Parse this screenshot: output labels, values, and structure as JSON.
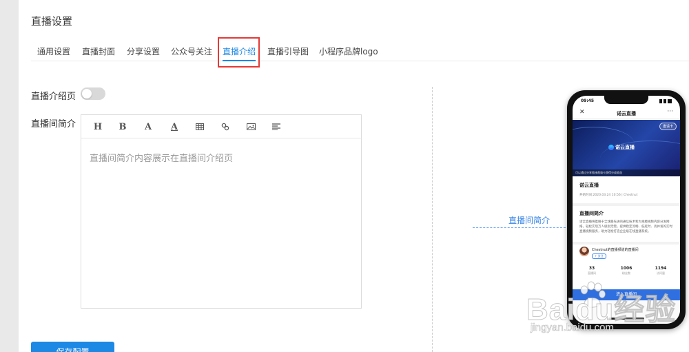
{
  "page": {
    "title": "直播设置"
  },
  "tabs": [
    {
      "label": "通用设置",
      "active": false
    },
    {
      "label": "直播封面",
      "active": false
    },
    {
      "label": "分享设置",
      "active": false
    },
    {
      "label": "公众号关注",
      "active": false
    },
    {
      "label": "直播介绍",
      "active": true
    },
    {
      "label": "直播引导图",
      "active": false
    },
    {
      "label": "小程序品牌logo",
      "active": false
    }
  ],
  "form": {
    "intro_page": {
      "label": "直播介绍页",
      "enabled": false
    },
    "room_intro": {
      "label": "直播间简介",
      "toolbar": [
        {
          "icon": "heading-icon",
          "glyph": "H"
        },
        {
          "icon": "bold-icon",
          "glyph": "B"
        },
        {
          "icon": "font-size-icon",
          "glyph": "A"
        },
        {
          "icon": "font-color-icon",
          "glyph": "A"
        },
        {
          "icon": "table-icon"
        },
        {
          "icon": "link-icon"
        },
        {
          "icon": "image-icon"
        },
        {
          "icon": "align-icon"
        }
      ],
      "placeholder": "直播间简介内容展示在直播间介绍页"
    }
  },
  "preview": {
    "callout": "直播间简介",
    "phone": {
      "time": "09:45",
      "nav_title": "诺云直播",
      "share_label": "邀请卡",
      "banner_logo": "诺云直播",
      "banner_note": "可以通过分享链接邀请卡获得分成收益",
      "room_name": "诺云直播",
      "start_time": "开始时间:2020.03.24 10:56 | Chestnut",
      "intro_title": "直播间简介",
      "intro_text": "诺云直播将着眼于全球最先进的通信技术和大规模视频内容分发网络，轻松实现万人级别无需，提供稳定流畅、低延时、高并发的实时直播视频服务，助力轻松打造企业级在线直播系统。",
      "channel": "Chestnut的直播频道的直播间",
      "follow": "+ 关注",
      "stats": [
        {
          "num": "33",
          "label": "直播间"
        },
        {
          "num": "1006",
          "label": "粉丝数"
        },
        {
          "num": "1194",
          "label": "访问量"
        }
      ],
      "enter_button": "进入直播间"
    }
  },
  "watermark": {
    "big": "Baidu经验",
    "small": "jingyan.baidu.com"
  },
  "actions": {
    "save": "保存配置"
  },
  "colors": {
    "accent": "#1e88e5",
    "highlight": "#e53935",
    "gutter": "#e9e9e9"
  }
}
